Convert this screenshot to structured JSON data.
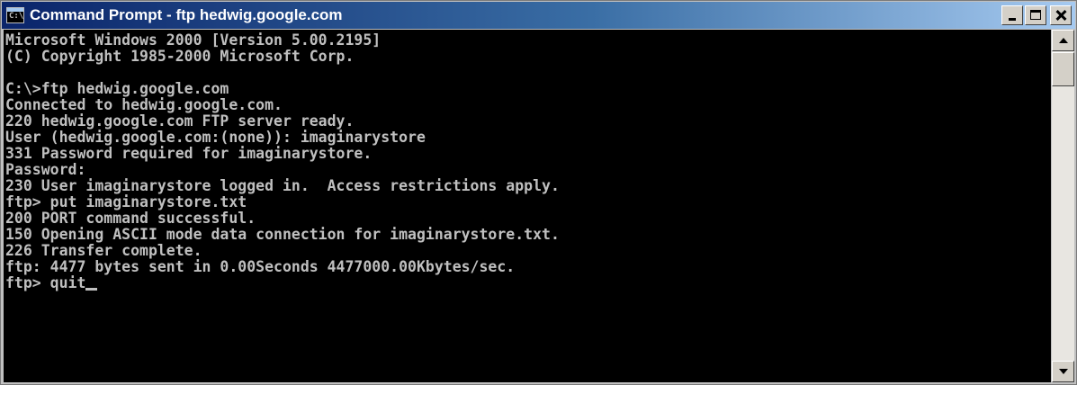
{
  "window": {
    "title": "Command Prompt - ftp hedwig.google.com",
    "icon": "command-prompt-icon",
    "icon_text": "C:\\"
  },
  "controls": {
    "minimize": "minimize-icon",
    "maximize": "maximize-icon",
    "close": "close-icon"
  },
  "console": {
    "lines": [
      "Microsoft Windows 2000 [Version 5.00.2195]",
      "(C) Copyright 1985-2000 Microsoft Corp.",
      "",
      "C:\\>ftp hedwig.google.com",
      "Connected to hedwig.google.com.",
      "220 hedwig.google.com FTP server ready.",
      "User (hedwig.google.com:(none)): imaginarystore",
      "331 Password required for imaginarystore.",
      "Password:",
      "230 User imaginarystore logged in.  Access restrictions apply.",
      "ftp> put imaginarystore.txt",
      "200 PORT command successful.",
      "150 Opening ASCII mode data connection for imaginarystore.txt.",
      "226 Transfer complete.",
      "ftp: 4477 bytes sent in 0.00Seconds 4477000.00Kbytes/sec.",
      "ftp> quit"
    ],
    "colors": {
      "background": "#000000",
      "text": "#c0c0c0"
    }
  },
  "scrollbar": {
    "up_icon": "scroll-up-arrow-icon",
    "down_icon": "scroll-down-arrow-icon"
  }
}
